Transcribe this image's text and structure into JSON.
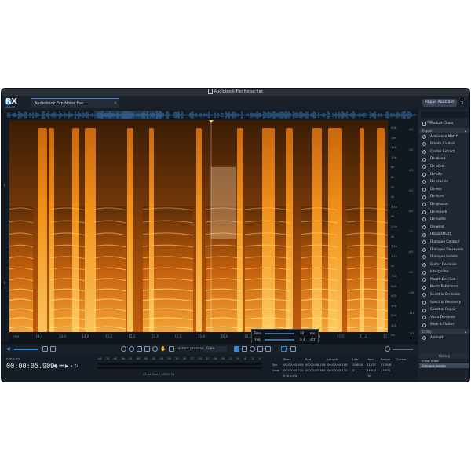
{
  "window": {
    "title": "Audiobook Fan Noise.flac"
  },
  "logo": {
    "text": "RX",
    "sub": "advanced"
  },
  "tab": {
    "label": "Audiobook Fan Noise.flac",
    "close": "×"
  },
  "assistant_button": "Repair Assistant",
  "brand_icon": "izotope-icon",
  "left_gutter": {
    "labels": [
      "L",
      "R"
    ]
  },
  "time_ticks": [
    "hms",
    "14.4",
    "14.6",
    "14.8",
    "15.0",
    "15.2",
    "15.4",
    "15.6",
    "15.8",
    "16.0",
    "16.2",
    "16.4",
    "16.6",
    "16.8",
    "17.0",
    "17.2",
    "17.4"
  ],
  "freq_ticks": [
    "20k",
    "15k",
    "12k",
    "10k",
    "8k",
    "6k",
    "5k",
    "4k",
    "3.5k",
    "3k",
    "2.5k",
    "2k",
    "1.5k",
    "1.2k",
    "1k",
    "700",
    "500",
    "400",
    "300",
    "200",
    "100"
  ],
  "freq_unit": "Hz",
  "db_ticks": [
    "-20",
    "-30",
    "-40",
    "-50",
    "-60",
    "-70",
    "-80",
    "-90",
    "-100",
    "-110",
    "-120"
  ],
  "panel": {
    "filter": "All",
    "module_chain": "Module Chain",
    "repair_header": "Repair",
    "modules": [
      "Ambience Match",
      "Breath Control",
      "Center Extract",
      "De-bleed",
      "De-click",
      "De-clip",
      "De-crackle",
      "De-ess",
      "De-hum",
      "De-plosive",
      "De-reverb",
      "De-rustle",
      "De-wind",
      "Deconstruct",
      "Dialogue Contour",
      "Dialogue De-reverb",
      "Dialogue Isolate",
      "Guitar De-noise",
      "Interpolate",
      "Mouth De-click",
      "Music Rebalance",
      "Spectral De-noise",
      "Spectral Recovery",
      "Spectral Repair",
      "Voice De-noise",
      "Wow & Flutter"
    ],
    "utility_header": "Utility",
    "utility_modules": [
      "Azimuth"
    ]
  },
  "history": {
    "title": "History",
    "items": [
      "Initial State",
      "Dialogue Isolate"
    ],
    "selected_index": 1
  },
  "toolbar": {
    "instant_process": "Instant process",
    "gain": "Gain"
  },
  "timecode": {
    "format": "h:m:s.ms",
    "value": "00:00:05.909"
  },
  "meter": {
    "scale": [
      "-Inf",
      "-70",
      "-60",
      "-56",
      "-51",
      "-48",
      "-45",
      "-42",
      "-39",
      "-36",
      "-33",
      "-30",
      "-27",
      "-24",
      "-21",
      "-18",
      "-15",
      "-12",
      "-9",
      "-6",
      "-3",
      "0"
    ],
    "format": "32-bit float | 48000 Hz"
  },
  "selection": {
    "headers": [
      "Start",
      "End",
      "Length",
      "Low",
      "High",
      "Range",
      "Cursor"
    ],
    "sel": {
      "label": "Sel",
      "start": "00:00:05.909",
      "end": "00:00:06.108",
      "length": "00:00:00.198",
      "low": "2960.8",
      "high": "11137",
      "range": "8176.8"
    },
    "view": {
      "label": "View",
      "start": "00:00:04.220",
      "end": "00:00:07.395",
      "length": "00:00:03.175",
      "low": "0",
      "high": "24000",
      "range": "24000"
    },
    "unit_time": "h:m:s.ms",
    "unit_freq": "Hz"
  },
  "time_popup": {
    "time_label": "Time",
    "time_value": "30",
    "time_unit": "ms",
    "freq_label": "Freq",
    "freq_value": "0.3",
    "freq_unit": "oct"
  },
  "colors": {
    "accent": "#3a88d1",
    "spectrogram_hot": "#ff9a1a",
    "background": "#1c2330"
  }
}
